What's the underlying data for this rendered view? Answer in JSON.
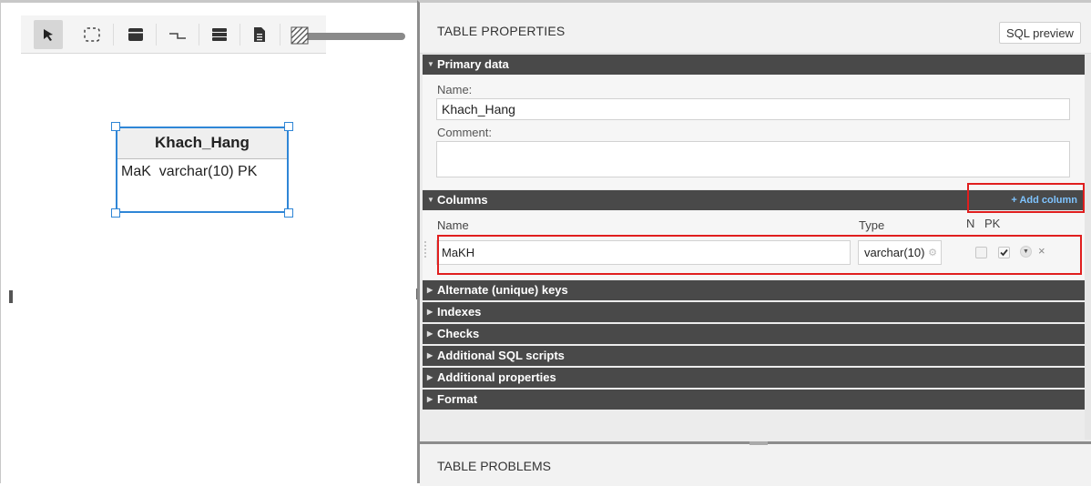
{
  "toolbar": {
    "tools": [
      "select-pointer-icon",
      "marquee-select-icon",
      "table-icon",
      "relation-icon",
      "list-icon",
      "note-icon",
      "hatch-pattern-icon"
    ]
  },
  "entity": {
    "name": "Khach_Hang",
    "row": "MaK  varchar(10) PK"
  },
  "props": {
    "title": "TABLE PROPERTIES",
    "sql_preview": "SQL preview",
    "primary": {
      "section": "Primary data",
      "name_label": "Name:",
      "name_value": "Khach_Hang",
      "comment_label": "Comment:",
      "comment_value": ""
    },
    "columns": {
      "section": "Columns",
      "add_column": "+ Add column",
      "headers": {
        "name": "Name",
        "type": "Type",
        "n": "N",
        "pk": "PK"
      },
      "row": {
        "name": "MaKH",
        "type": "varchar(10)",
        "n_checked": false,
        "pk_checked": true
      }
    },
    "sections": [
      "Alternate (unique) keys",
      "Indexes",
      "Checks",
      "Additional SQL scripts",
      "Additional properties",
      "Format"
    ]
  },
  "problems": {
    "title": "TABLE PROBLEMS"
  },
  "colors": {
    "selection": "#2f86d6",
    "section_bar": "#494949",
    "highlight": "#e01e1e",
    "link": "#7fc4ff"
  }
}
